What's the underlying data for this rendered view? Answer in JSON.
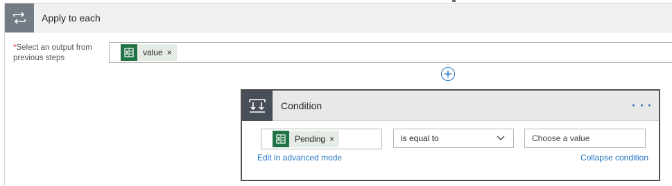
{
  "apply_to_each": {
    "title": "Apply to each",
    "icon": "loop-icon",
    "required_marker": "*",
    "output_label": "Select an output from previous steps",
    "selected_token": {
      "label": "value",
      "icon": "excel-icon",
      "remove": "×"
    }
  },
  "add_step": {
    "icon": "plus-circle-icon"
  },
  "condition": {
    "title": "Condition",
    "icon": "condition-icon",
    "more_icon": "ellipsis-icon",
    "left_token": {
      "label": "Pending",
      "icon": "excel-icon",
      "remove": "×"
    },
    "operator": "is equal to",
    "value_placeholder": "Choose a value",
    "edit_link": "Edit in advanced mode",
    "collapse_link": "Collapse condition"
  },
  "colors": {
    "accent": "#2074c4",
    "excel_green": "#217346",
    "token_bg": "#e5ece6",
    "apply_icon_bg": "#737b85",
    "condition_icon_bg": "#484f58",
    "required": "#d13438"
  }
}
